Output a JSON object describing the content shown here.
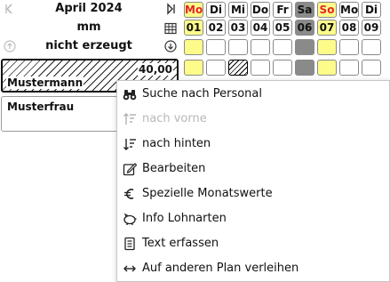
{
  "header": {
    "month": "April 2024",
    "unit": "mm",
    "status": "nicht erzeugt"
  },
  "days": [
    {
      "wd": "Mo",
      "num": "01",
      "type": "holiday"
    },
    {
      "wd": "Di",
      "num": "02",
      "type": "normal"
    },
    {
      "wd": "Mi",
      "num": "03",
      "type": "normal"
    },
    {
      "wd": "Do",
      "num": "04",
      "type": "normal"
    },
    {
      "wd": "Fr",
      "num": "05",
      "type": "normal"
    },
    {
      "wd": "Sa",
      "num": "06",
      "type": "saturday"
    },
    {
      "wd": "So",
      "num": "07",
      "type": "sunday"
    },
    {
      "wd": "Mo",
      "num": "08",
      "type": "normal"
    },
    {
      "wd": "Di",
      "num": "09",
      "type": "normal"
    }
  ],
  "employees": [
    {
      "name": "Mustermann",
      "hours": "40,00"
    },
    {
      "name": "Musterfrau",
      "hours": ""
    }
  ],
  "context_menu": {
    "items": [
      {
        "label": "Suche nach Personal",
        "icon": "binoculars-icon",
        "enabled": true
      },
      {
        "label": "nach vorne",
        "icon": "sort-up-icon",
        "enabled": false
      },
      {
        "label": "nach hinten",
        "icon": "sort-down-icon",
        "enabled": true
      },
      {
        "label": "Bearbeiten",
        "icon": "edit-icon",
        "enabled": true
      },
      {
        "label": "Spezielle Monatswerte",
        "icon": "euro-icon",
        "enabled": true
      },
      {
        "label": "Info Lohnarten",
        "icon": "piggy-bank-icon",
        "enabled": true
      },
      {
        "label": "Text erfassen",
        "icon": "document-icon",
        "enabled": true
      },
      {
        "label": "Auf anderen Plan verleihen",
        "icon": "swap-arrows-icon",
        "enabled": true
      }
    ]
  },
  "colors": {
    "holiday_bg": "#fdfb8a",
    "weekend_text": "#e3262a",
    "saturday_bg": "#8a8a8a"
  }
}
